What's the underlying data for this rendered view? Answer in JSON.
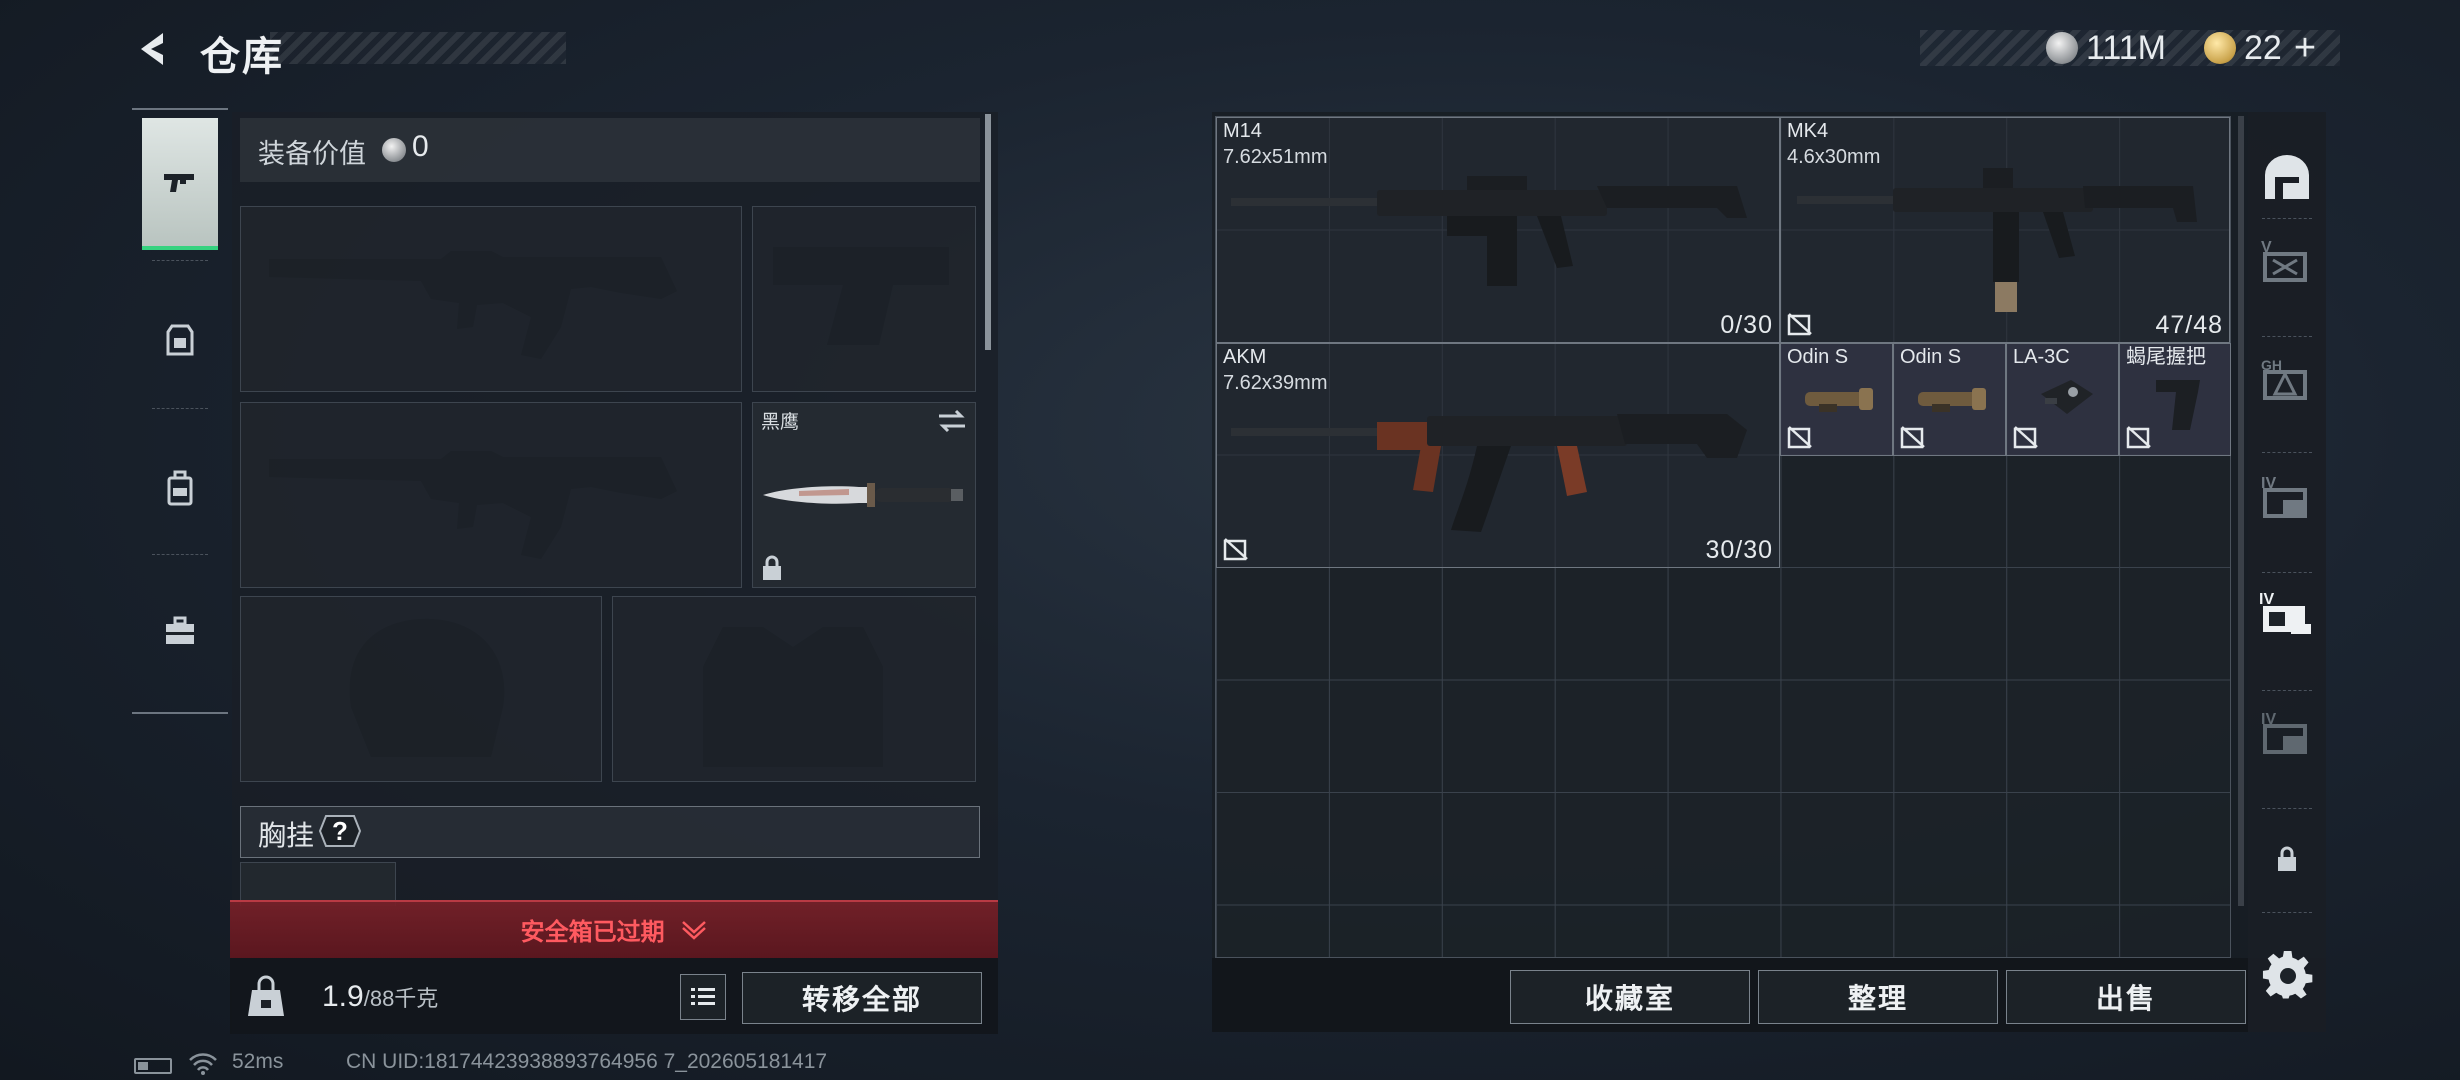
{
  "header": {
    "title": "仓库",
    "silver_amount": "111M",
    "gold_amount": "22",
    "gold_plus": "+"
  },
  "equipment": {
    "value_label": "装备价值",
    "value": "0",
    "knife_name": "黑鹰",
    "chest_rig_label": "胸挂",
    "chest_rig_help": "?",
    "safebox_warning": "安全箱已过期",
    "weight_current": "1.9",
    "weight_max": "/88千克",
    "transfer_all": "转移全部"
  },
  "storage": {
    "items": [
      {
        "name": "M14",
        "caliber": "7.62x51mm",
        "ammo": "0/30"
      },
      {
        "name": "MK4",
        "caliber": "4.6x30mm",
        "ammo": "47/48"
      },
      {
        "name": "AKM",
        "caliber": "7.62x39mm",
        "ammo": "30/30"
      },
      {
        "name": "Odin S"
      },
      {
        "name": "Odin S"
      },
      {
        "name": "LA-3C"
      },
      {
        "name": "蝎尾握把"
      }
    ],
    "buttons": {
      "collection": "收藏室",
      "organize": "整理",
      "sell": "出售"
    }
  },
  "status_bar": {
    "ping": "52ms",
    "uid": "CN UID:18174423938893764956 7_202605181417"
  },
  "colors": {
    "accent_green": "#35d27f",
    "warning_red": "#ff5a60"
  }
}
